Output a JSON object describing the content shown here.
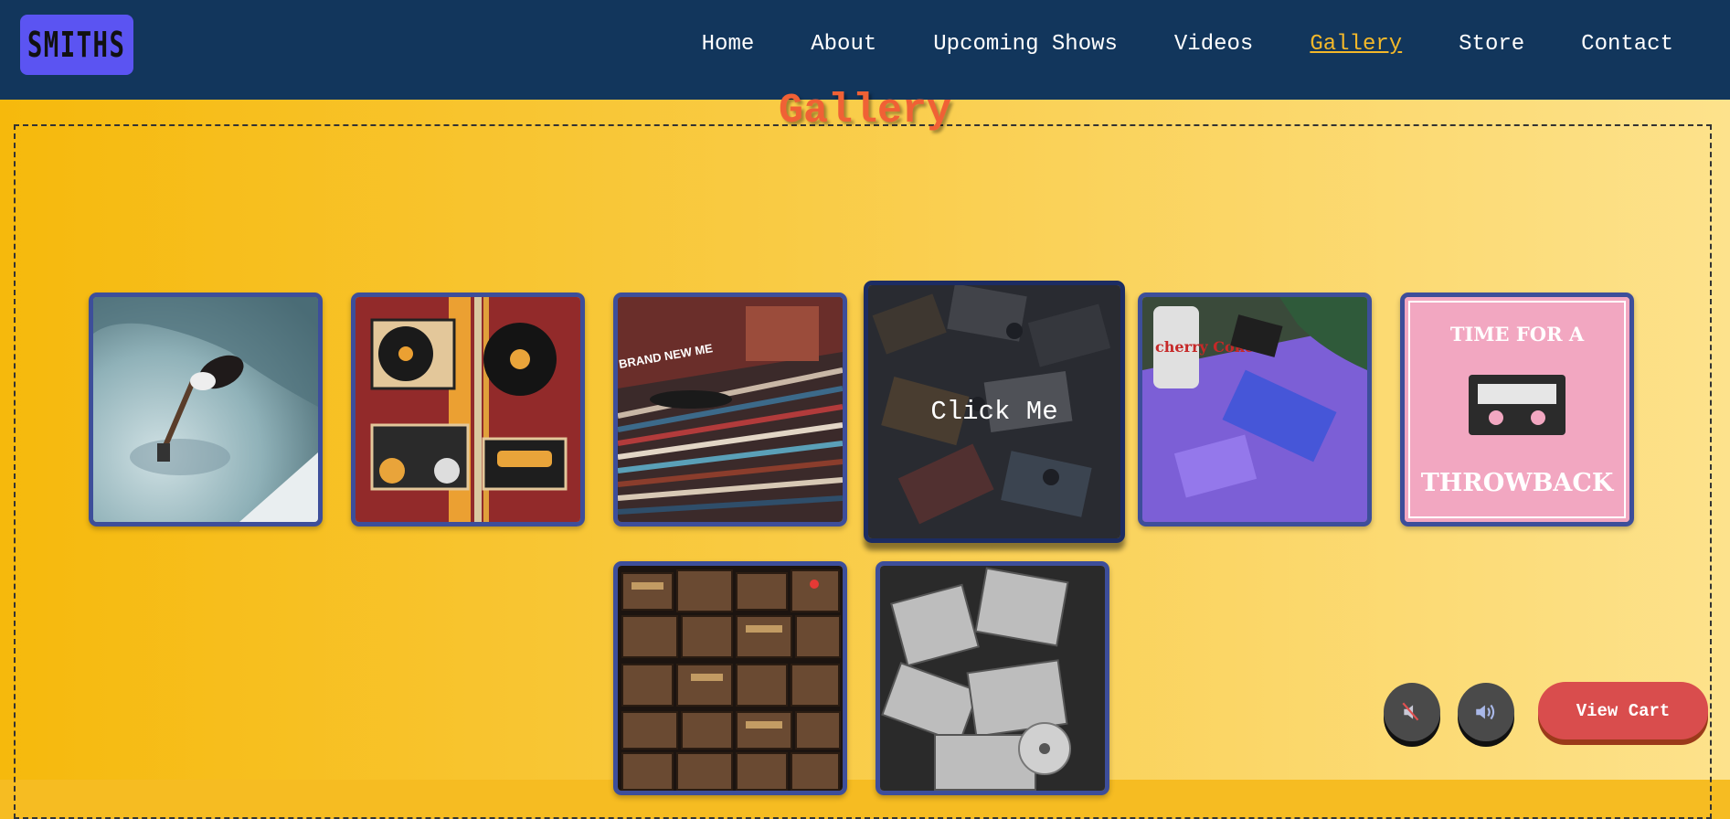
{
  "brand": {
    "logo_text": "SMITHS"
  },
  "nav": {
    "items": [
      {
        "label": "Home"
      },
      {
        "label": "About"
      },
      {
        "label": "Upcoming Shows"
      },
      {
        "label": "Videos"
      },
      {
        "label": "Gallery",
        "active": true
      },
      {
        "label": "Store"
      },
      {
        "label": "Contact"
      }
    ]
  },
  "gallery": {
    "title": "Gallery",
    "hover_overlay_label": "Click Me",
    "images": [
      {
        "subject": "guitar-floating-in-pool"
      },
      {
        "subject": "retro-turntables-boombox-cassette-poster",
        "text": ""
      },
      {
        "subject": "vinyl-record-crates",
        "text": "BRAND NEW ME"
      },
      {
        "subject": "cassette-tapes-pile",
        "hovered": true
      },
      {
        "subject": "cherry-coke-and-cassette-player",
        "text": "cherry Coke"
      },
      {
        "subject": "throwback-cassette-poster",
        "text_top": "TIME FOR A",
        "text_bottom": "THROWBACK"
      },
      {
        "subject": "stacked-vintage-radios"
      },
      {
        "subject": "stacked-cd-cases"
      }
    ]
  },
  "controls": {
    "mute_icon": "speaker-muted-icon",
    "unmute_icon": "speaker-on-icon",
    "cart_label": "View Cart"
  },
  "colors": {
    "nav_bg": "#12365c",
    "logo_bg": "#5b54f2",
    "active_link": "#f3b82a",
    "title": "#f06135",
    "tile_border": "#3d4e9a",
    "cart_button": "#d94d4d"
  }
}
